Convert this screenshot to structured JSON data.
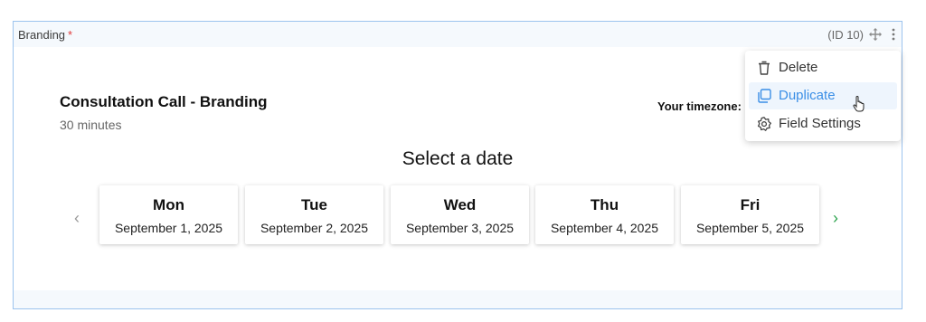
{
  "field": {
    "label": "Branding",
    "required_mark": "*",
    "id_text": "(ID 10)"
  },
  "booking": {
    "title": "Consultation Call - Branding",
    "duration": "30 minutes",
    "timezone_label": "Your timezone:",
    "select_heading": "Select a date"
  },
  "days": [
    {
      "day": "Mon",
      "date": "September 1, 2025"
    },
    {
      "day": "Tue",
      "date": "September 2, 2025"
    },
    {
      "day": "Wed",
      "date": "September 3, 2025"
    },
    {
      "day": "Thu",
      "date": "September 4, 2025"
    },
    {
      "day": "Fri",
      "date": "September 5, 2025"
    }
  ],
  "nav": {
    "prev": "‹",
    "next": "›"
  },
  "menu": {
    "items": [
      {
        "label": "Delete",
        "icon": "trash-icon"
      },
      {
        "label": "Duplicate",
        "icon": "duplicate-icon",
        "hovered": true
      },
      {
        "label": "Field Settings",
        "icon": "gear-icon"
      }
    ]
  },
  "colors": {
    "border": "#9cc3ee",
    "accent": "#3a8ee6",
    "next_arrow": "#2ea44f",
    "required": "#e23c3c"
  }
}
